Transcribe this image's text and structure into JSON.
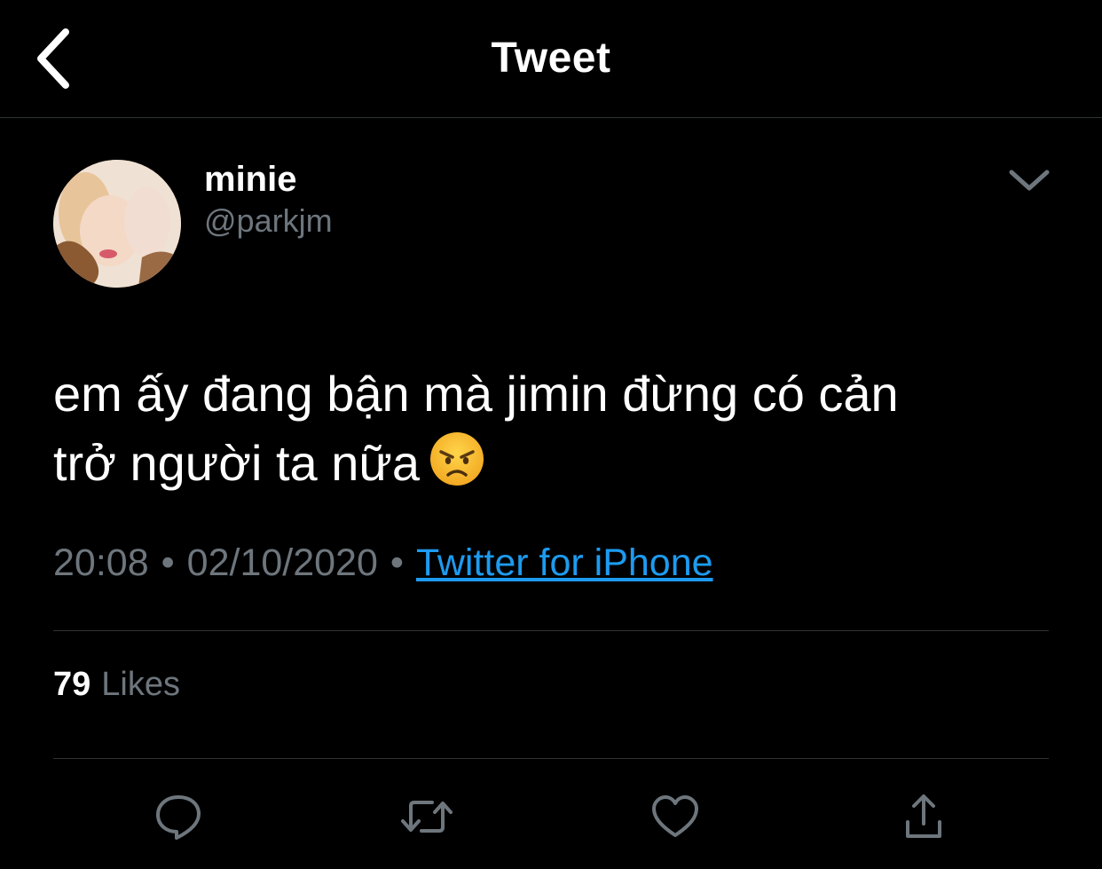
{
  "header": {
    "title": "Tweet",
    "back_icon": "chevron-left-icon"
  },
  "tweet": {
    "author": {
      "display_name": "minie",
      "handle": "@parkjm",
      "avatar": "avatar-photo"
    },
    "menu_icon": "chevron-down-icon",
    "text_lines": [
      "em ấy đang bận mà jimin đừng có cản",
      "trở người ta nữa"
    ],
    "emoji": "angry-face-emoji",
    "time": "20:08",
    "separator": "•",
    "date": "02/10/2020",
    "source": "Twitter for iPhone",
    "likes": {
      "count": "79",
      "label": "Likes"
    }
  },
  "actions": [
    {
      "name": "reply",
      "icon": "reply-icon"
    },
    {
      "name": "retweet",
      "icon": "retweet-icon"
    },
    {
      "name": "like",
      "icon": "heart-icon"
    },
    {
      "name": "share",
      "icon": "share-icon"
    }
  ],
  "colors": {
    "background": "#000000",
    "text": "#ffffff",
    "secondary": "#6e767d",
    "link": "#1d9bf0",
    "divider": "#2f3336",
    "emoji": "#f7c12b"
  }
}
